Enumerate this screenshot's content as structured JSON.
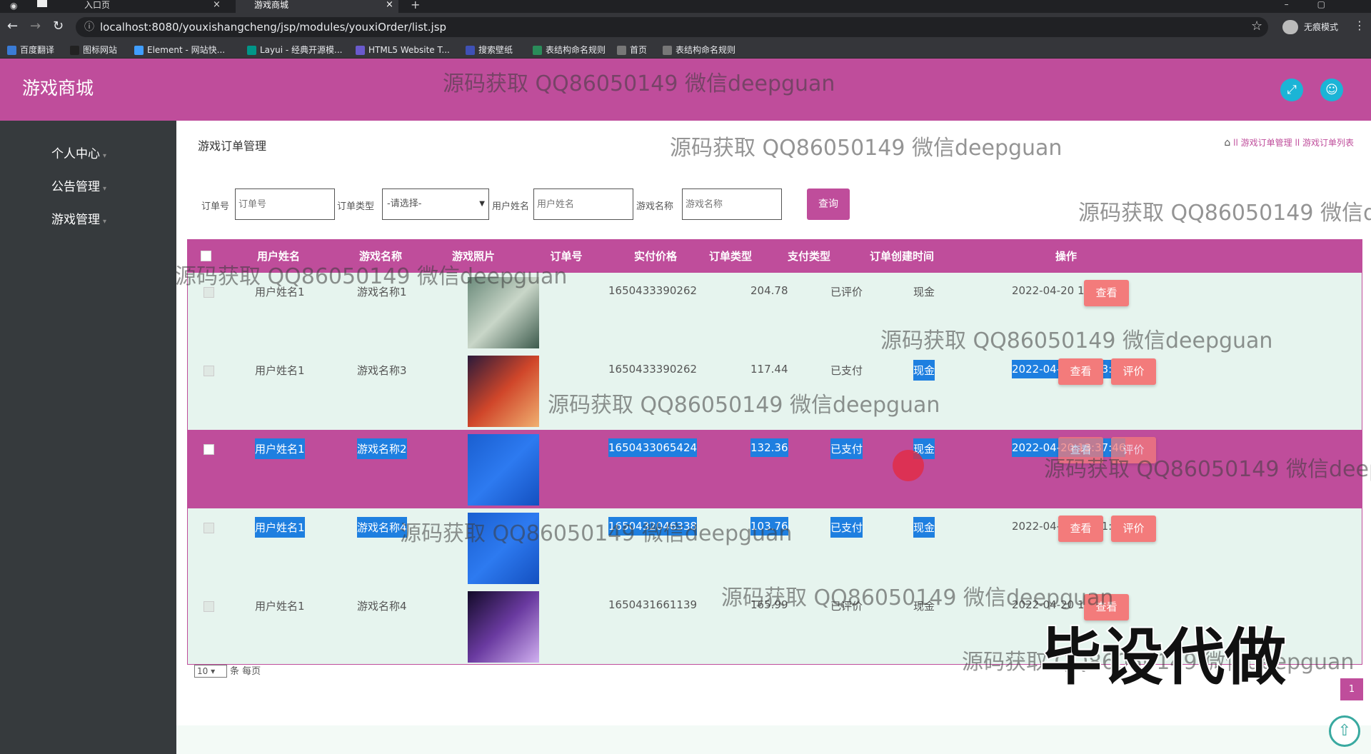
{
  "browser": {
    "tabs": [
      {
        "label": "入口页"
      },
      {
        "label": "游戏商城"
      }
    ],
    "url": "localhost:8080/youxishangcheng/jsp/modules/youxiOrder/list.jsp",
    "incognito_label": "无痕模式",
    "bookmarks": [
      {
        "label": "百度翻译",
        "color": "#3a7bd5"
      },
      {
        "label": "图标网站",
        "color": "#222"
      },
      {
        "label": "Element - 网站快...",
        "color": "#409eff"
      },
      {
        "label": "Layui - 经典开源模...",
        "color": "#009688"
      },
      {
        "label": "HTML5 Website T...",
        "color": "#6a5acd"
      },
      {
        "label": "搜索壁纸",
        "color": "#3f51b5"
      },
      {
        "label": "表结构命名规则",
        "color": "#2a8c5a"
      },
      {
        "label": "首页",
        "color": "#777"
      },
      {
        "label": "表结构命名规则",
        "color": "#777"
      }
    ]
  },
  "app": {
    "brand": "游戏商城",
    "header_icons": [
      "fullscreen-icon",
      "user-icon"
    ],
    "accent_color": "#bf4d9b"
  },
  "sidebar": {
    "items": [
      {
        "label": "个人中心"
      },
      {
        "label": "公告管理"
      },
      {
        "label": "游戏管理"
      }
    ]
  },
  "page": {
    "title": "游戏订单管理",
    "breadcrumb": [
      "游戏订单管理",
      "游戏订单列表"
    ],
    "breadcrumb_separator": "ll"
  },
  "search": {
    "order_no_label": "订单号",
    "order_no_placeholder": "订单号",
    "order_type_label": "订单类型",
    "order_type_selected": "-请选择-",
    "user_name_label": "用户姓名",
    "user_name_placeholder": "用户姓名",
    "game_name_label": "游戏名称",
    "game_name_placeholder": "游戏名称",
    "query_label": "查询"
  },
  "table": {
    "headers": [
      "用户姓名",
      "游戏名称",
      "游戏照片",
      "订单号",
      "实付价格",
      "订单类型",
      "支付类型",
      "订单创建时间",
      "操作"
    ],
    "rows": [
      {
        "user": "用户姓名1",
        "game": "游戏名称1",
        "order_no": "1650433390262",
        "price": "204.78",
        "order_type": "已评价",
        "pay_type": "现金",
        "created": "2022-04-20 13:43:10",
        "actions": [
          "查看"
        ],
        "photo_colors": [
          "#6a8a7a",
          "#c9d6c8",
          "#3c5a4c"
        ]
      },
      {
        "user": "用户姓名1",
        "game": "游戏名称3",
        "order_no": "1650433390262",
        "price": "117.44",
        "order_type": "已支付",
        "pay_type": "现金",
        "created": "2022-04-20 13:43:10",
        "actions": [
          "查看",
          "评价"
        ],
        "photo_colors": [
          "#2b1a3a",
          "#d0462a",
          "#f0b070"
        ]
      },
      {
        "user": "用户姓名1",
        "game": "游戏名称2",
        "order_no": "1650433065424",
        "price": "132.36",
        "order_type": "已支付",
        "pay_type": "现金",
        "created": "2022-04-20 13:37:46",
        "actions": [
          "查看",
          "评价"
        ],
        "photo_colors": [
          "#1a5fd0",
          "#2d7af0",
          "#1450c0"
        ]
      },
      {
        "user": "用户姓名1",
        "game": "游戏名称4",
        "order_no": "1650432046338",
        "price": "103.76",
        "order_type": "已支付",
        "pay_type": "现金",
        "created": "2022-04-20 13:21:25",
        "actions": [
          "查看",
          "评价"
        ],
        "photo_colors": [
          "#1a5fd0",
          "#2d7af0",
          "#1450c0"
        ]
      },
      {
        "user": "用户姓名1",
        "game": "游戏名称4",
        "order_no": "1650431661139",
        "price": "165.99",
        "order_type": "已评价",
        "pay_type": "现金",
        "created": "2022-04-20 13:14:21",
        "actions": [
          "查看"
        ],
        "photo_colors": [
          "#120a28",
          "#6a3aa0",
          "#d0b0f0"
        ]
      }
    ]
  },
  "pager": {
    "page_size": "10",
    "page_size_suffix": "条 每页",
    "current_page": "1"
  },
  "overlay": {
    "watermark": "源码获取 QQ86050149 微信deepguan",
    "stamp": "毕设代做"
  }
}
